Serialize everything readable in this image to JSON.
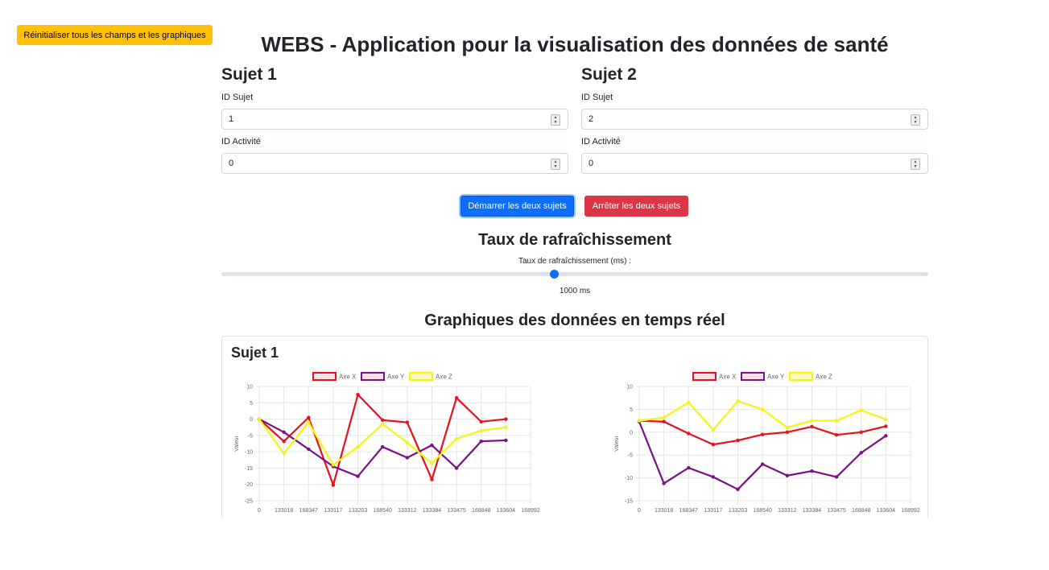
{
  "header": {
    "reset_label": "Réinitialiser tous les champs et les graphiques",
    "title": "WEBS - Application pour la visualisation des données de santé"
  },
  "subject1": {
    "heading": "Sujet 1",
    "id_label": "ID Sujet",
    "id_value": "1",
    "activity_label": "ID Activité",
    "activity_value": "0"
  },
  "subject2": {
    "heading": "Sujet 2",
    "id_label": "ID Sujet",
    "id_value": "2",
    "activity_label": "ID Activité",
    "activity_value": "0"
  },
  "controls": {
    "start_label": "Démarrer les deux sujets",
    "stop_label": "Arrêter les deux sujets"
  },
  "refresh": {
    "title": "Taux de rafraîchissement",
    "label": "Taux de rafraîchissement (ms) :",
    "slider_value": 0.47,
    "value_text": "1000 ms"
  },
  "charts_section": {
    "title": "Graphiques des données en temps réel",
    "card_title": "Sujet 1"
  },
  "colors": {
    "axis_x": "#e8101c",
    "axis_y": "#7a1184",
    "axis_z": "#f5f514",
    "primary": "#0d6efd",
    "danger": "#dc3545",
    "warning": "#ffc107"
  },
  "chart_data": [
    {
      "type": "line",
      "categories": [
        "0",
        "133018",
        "168347",
        "133117",
        "133203",
        "168540",
        "133312",
        "133384",
        "133475",
        "168848",
        "133604",
        "168992"
      ],
      "ylabel": "Valeur",
      "ylim": [
        -25,
        10
      ],
      "yticks": [
        10,
        5,
        0,
        -5,
        -10,
        -15,
        -20,
        -25
      ],
      "grid": true,
      "legend": "top-center",
      "series": [
        {
          "name": "Axe X",
          "color": "#e8101c",
          "values": [
            0,
            -6.8,
            0.5,
            -20.2,
            7.5,
            -0.3,
            -1,
            -18.5,
            6.5,
            -0.8,
            0
          ]
        },
        {
          "name": "Axe Y",
          "color": "#7a1184",
          "values": [
            0,
            -4,
            -9.2,
            -14.5,
            -17.5,
            -8.5,
            -11.8,
            -8,
            -15,
            -6.8,
            -6.5
          ]
        },
        {
          "name": "Axe Z",
          "color": "#f5f514",
          "values": [
            0,
            -10.5,
            -1,
            -14,
            -8.5,
            -1.5,
            -7.2,
            -13.5,
            -6,
            -3.5,
            -2.5
          ]
        }
      ]
    },
    {
      "type": "line",
      "categories": [
        "0",
        "133018",
        "168347",
        "133117",
        "133203",
        "168540",
        "133312",
        "133384",
        "133475",
        "168848",
        "133604",
        "168992"
      ],
      "ylabel": "Valeur",
      "ylim": [
        -15,
        10
      ],
      "yticks": [
        10,
        5,
        0,
        -5,
        -10,
        -15
      ],
      "grid": true,
      "legend": "top-center",
      "series": [
        {
          "name": "Axe X",
          "color": "#e8101c",
          "values": [
            2.5,
            2.3,
            -0.3,
            -2.7,
            -1.8,
            -0.5,
            0,
            1.2,
            -0.6,
            0,
            1.3
          ]
        },
        {
          "name": "Axe Y",
          "color": "#7a1184",
          "values": [
            2.3,
            -11.2,
            -7.8,
            -9.8,
            -12.5,
            -7,
            -9.5,
            -8.5,
            -9.8,
            -4.5,
            -0.8
          ]
        },
        {
          "name": "Axe Z",
          "color": "#f5f514",
          "values": [
            2.5,
            3.2,
            6.5,
            0.5,
            6.8,
            5,
            1,
            2.5,
            2.5,
            4.8,
            2.8
          ]
        }
      ]
    }
  ]
}
